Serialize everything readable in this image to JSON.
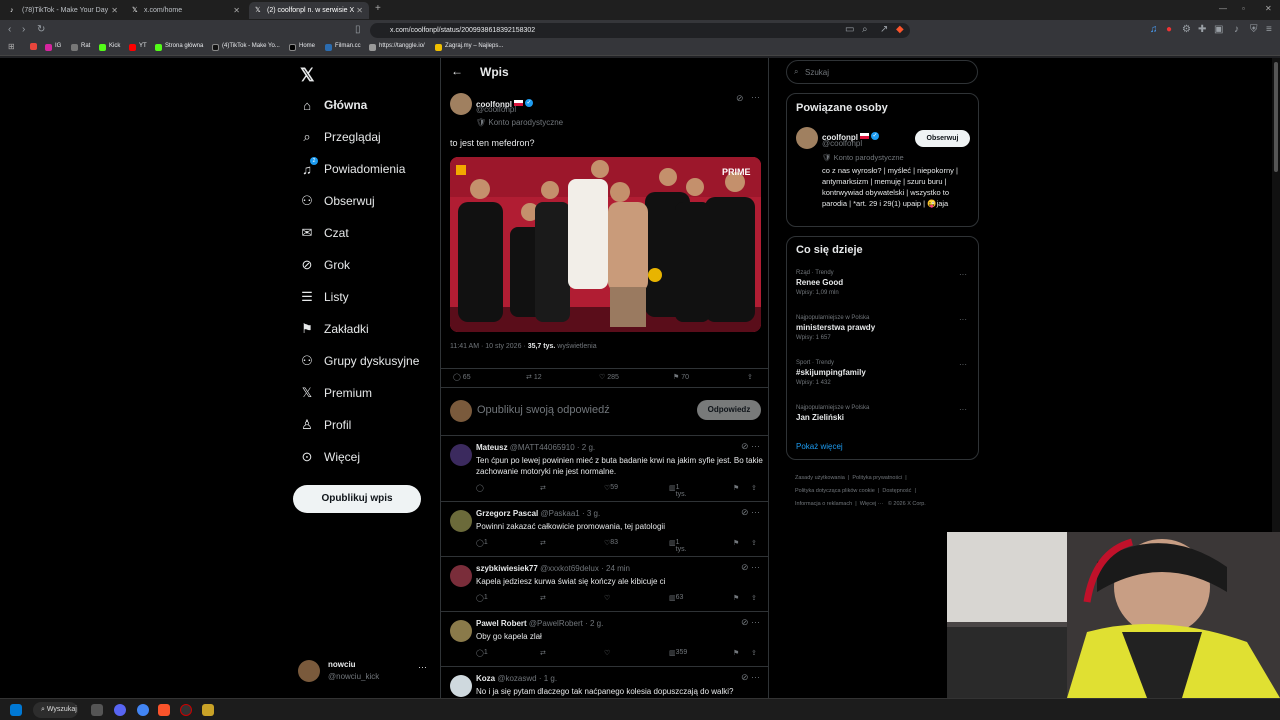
{
  "browser": {
    "tabs": [
      {
        "label": "(78)TikTok - Make Your Day"
      },
      {
        "label": "x.com/home"
      },
      {
        "label": "(2) coolfonpl n. w serwisie X"
      }
    ],
    "url": "x.com/coolfonpl/status/2009938618392158302",
    "bookmarks": [
      "IG",
      "Rat",
      "Kick",
      "YT",
      "Strona główna",
      "(4)TikTok - Make Yo...",
      "Home",
      "Filman.cc",
      "https://tanggle.io/",
      "Zagraj.my – Najleps..."
    ]
  },
  "nav": {
    "items": [
      {
        "label": "Główna",
        "icon": "home-icon"
      },
      {
        "label": "Przeglądaj",
        "icon": "search-icon"
      },
      {
        "label": "Powiadomienia",
        "icon": "bell-icon",
        "badge": "2"
      },
      {
        "label": "Obserwuj",
        "icon": "follow-icon"
      },
      {
        "label": "Czat",
        "icon": "mail-icon"
      },
      {
        "label": "Grok",
        "icon": "grok-icon"
      },
      {
        "label": "Listy",
        "icon": "list-icon"
      },
      {
        "label": "Zakładki",
        "icon": "bookmark-icon"
      },
      {
        "label": "Grupy dyskusyjne",
        "icon": "people-icon"
      },
      {
        "label": "Premium",
        "icon": "x-icon"
      },
      {
        "label": "Profil",
        "icon": "person-icon"
      },
      {
        "label": "Więcej",
        "icon": "more-icon"
      }
    ],
    "post_button": "Opublikuj wpis",
    "account": {
      "name": "nowciu",
      "handle": "@nowciu_kick"
    }
  },
  "main": {
    "title": "Wpis",
    "tweet": {
      "name": "coolfonpl",
      "handle": "@coolfonpl",
      "label": "Konto parodystyczne",
      "text": "to jest ten mefedron?",
      "time": "11:41 AM · 10 sty 2026 ·",
      "views": "35,7 tys.",
      "views_label": "wyświetlenia",
      "replies": "65",
      "retweets": "12",
      "likes": "285",
      "bookmarks": "70"
    },
    "reply_placeholder": "Opublikuj swoją odpowiedź",
    "reply_button": "Odpowiedz",
    "comments": [
      {
        "name": "Mateusz",
        "handle": "@MATT44065910 · 2 g.",
        "text": "Ten ćpun po lewej powinien mieć z buta badanie krwi na jakim syfie jest. Bo takie zachowanie motoryki nie jest normalne.",
        "replies": "",
        "likes": "59",
        "views": "1 tys.",
        "color": "#3b2a5e"
      },
      {
        "name": "Grzegorz Pascal",
        "handle": "@Paskaa1 · 3 g.",
        "text": "Powinni zakazać całkowicie promowania, tej patologii",
        "replies": "1",
        "likes": "83",
        "views": "1 tys.",
        "color": "#6b6a3a"
      },
      {
        "name": "szybkiwiesiek77",
        "handle": "@xxxkot69delux · 24 min",
        "text": "Kapela jedziesz kurwa świat się kończy ale kibicuje ci",
        "replies": "1",
        "likes": "",
        "views": "63",
        "color": "#7a2d3a"
      },
      {
        "name": "Pawel Robert",
        "handle": "@PawelRobert · 2 g.",
        "text": "Oby go kapela zlał",
        "replies": "1",
        "likes": "",
        "views": "359",
        "color": "#8a7a4a"
      },
      {
        "name": "Koza",
        "handle": "@kozaswd · 1 g.",
        "text": "No i ja się pytam dlaczego tak naćpanego kolesia dopuszczają do walki?",
        "replies": "",
        "likes": "",
        "views": "",
        "color": "#cfd9de"
      }
    ]
  },
  "right": {
    "search_placeholder": "Szukaj",
    "related_title": "Powiązane osoby",
    "person": {
      "name": "coolfonpl",
      "handle": "@coolfonpl",
      "label": "Konto parodystyczne",
      "follow": "Obserwuj",
      "bio": "co z nas wyrosło? | myśleć | niepokorny | antymarksizm | memuję | szuru buru | kontrwywiad obywatelski | wszystko to parodia | *art. 29 i 29(1) upaip | 😜jaja"
    },
    "trends_title": "Co się dzieje",
    "trends": [
      {
        "category": "Rząd · Trendy",
        "name": "Renee Good",
        "posts": "Wpisy: 1,09 mln"
      },
      {
        "category": "Najpopularniejsze w Polska",
        "name": "ministerstwa prawdy",
        "posts": "Wpisy: 1 657"
      },
      {
        "category": "Sport · Trendy",
        "name": "#skijumpingfamily",
        "posts": "Wpisy: 1 432"
      },
      {
        "category": "Najpopularniejsze w Polska",
        "name": "Jan Zieliński",
        "posts": ""
      }
    ],
    "show_more": "Pokaż więcej",
    "footer": [
      "Zasady użytkowania",
      "Polityka prywatności",
      "Polityka dotycząca plików cookie",
      "Dostępność",
      "Informacja o reklamach",
      "Więcej ···",
      "© 2026 X Corp."
    ]
  },
  "taskbar": {
    "search": "Wyszukaj"
  },
  "colors": {
    "accent": "#1d9bf0",
    "bg": "#000000",
    "border": "#2f3336",
    "muted": "#71767b"
  }
}
